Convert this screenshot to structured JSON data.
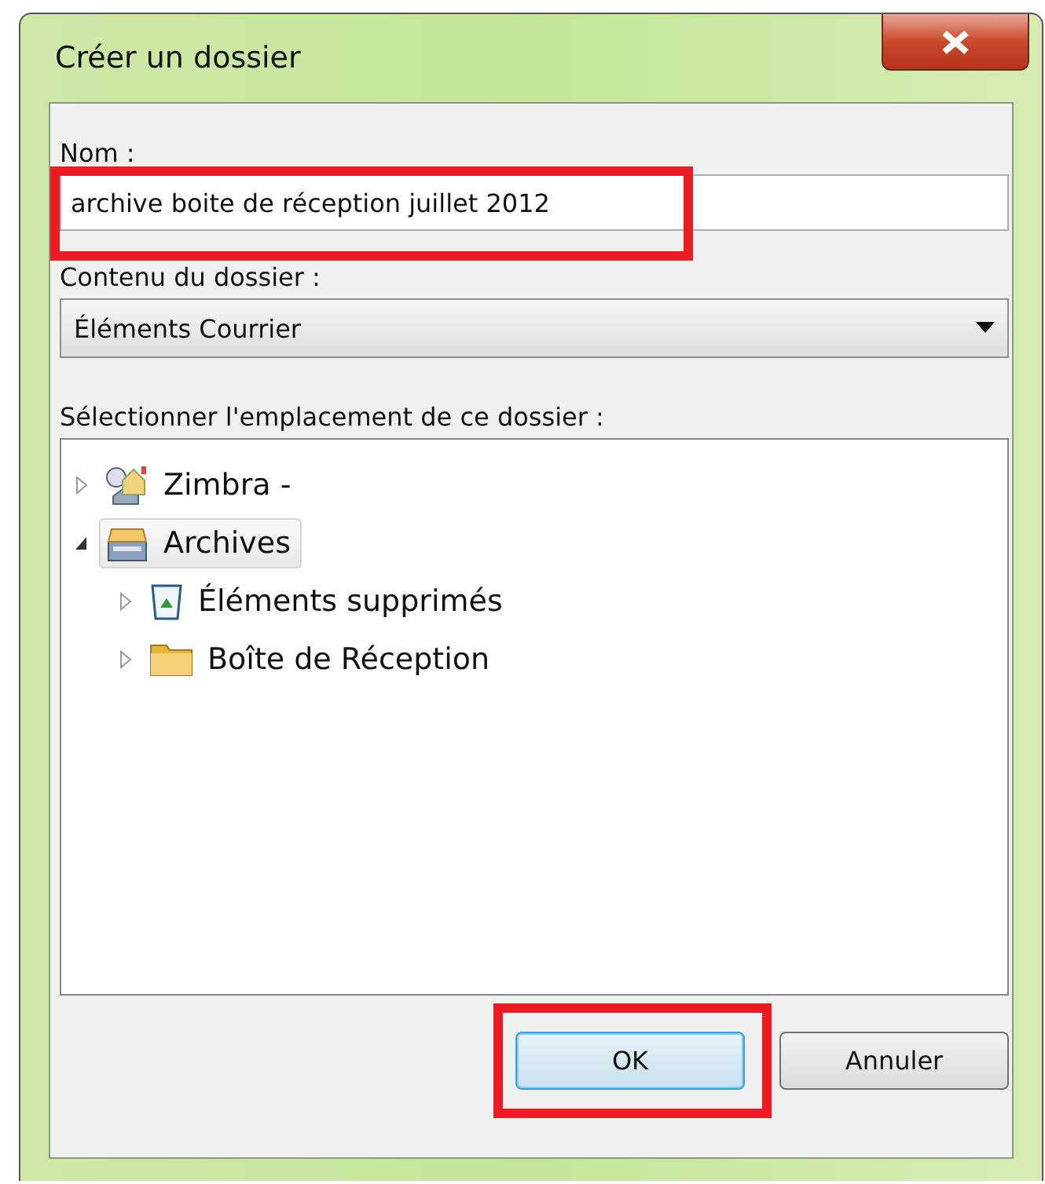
{
  "window": {
    "title": "Créer un dossier"
  },
  "name_field": {
    "label": "Nom :",
    "value": "archive boite de réception juillet 2012",
    "highlighted": true
  },
  "content_field": {
    "label": "Contenu du dossier :",
    "value": "Éléments Courrier"
  },
  "location": {
    "label": "Sélectionner l'emplacement de ce dossier :",
    "tree": [
      {
        "label": "Zimbra -",
        "kind": "account",
        "expanded": false,
        "selected": false
      },
      {
        "label": "Archives",
        "kind": "archive",
        "expanded": true,
        "selected": true,
        "children": [
          {
            "label": "Éléments supprimés",
            "kind": "trash",
            "expanded": false,
            "selected": false
          },
          {
            "label": "Boîte de Réception",
            "kind": "folder",
            "expanded": false,
            "selected": false
          }
        ]
      }
    ]
  },
  "buttons": [
    {
      "label": "OK",
      "default": true,
      "highlighted": true
    },
    {
      "label": "Annuler",
      "default": false,
      "highlighted": false
    }
  ]
}
